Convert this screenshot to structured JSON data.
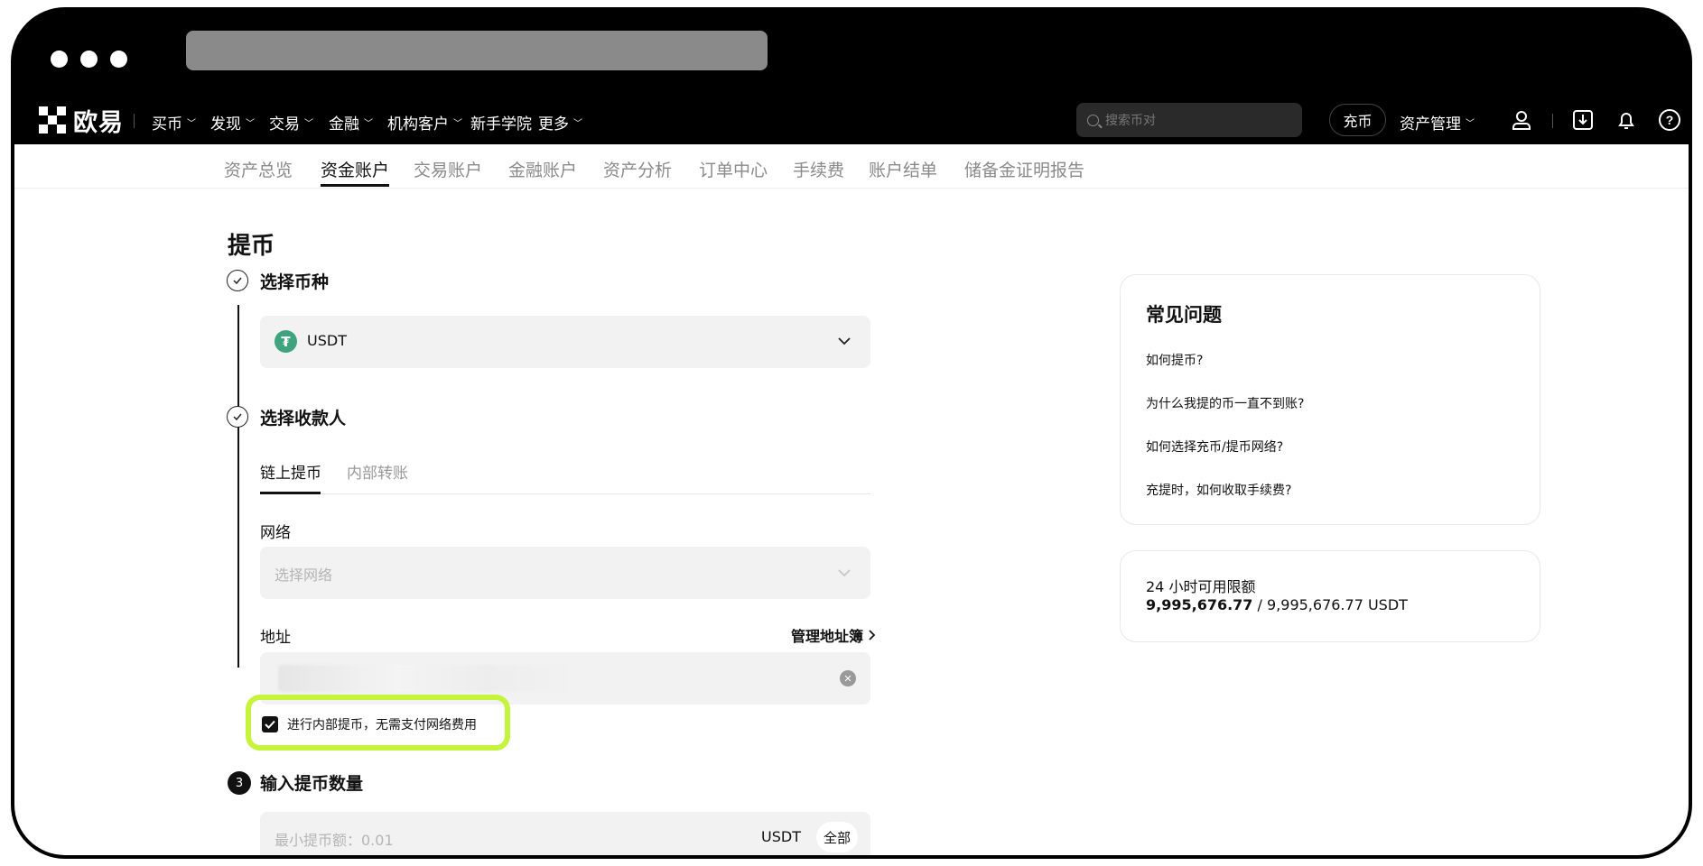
{
  "app": {
    "logo_text": "欧易"
  },
  "topnav": {
    "items": [
      "买币",
      "发现",
      "交易",
      "金融",
      "机构客户",
      "新手学院",
      "更多"
    ],
    "search_placeholder": "搜索币对",
    "deposit_label": "充币",
    "asset_management": "资产管理"
  },
  "subnav": {
    "items": [
      "资产总览",
      "资金账户",
      "交易账户",
      "金融账户",
      "资产分析",
      "订单中心",
      "手续费",
      "账户结单",
      "储备金证明报告"
    ],
    "active_index": 1
  },
  "page": {
    "title": "提币"
  },
  "steps": {
    "step1": {
      "title": "选择币种",
      "coin": "USDT",
      "coin_icon": "₮"
    },
    "step2": {
      "title": "选择收款人",
      "tabs": [
        "链上提币",
        "内部转账"
      ],
      "network_label": "网络",
      "network_placeholder": "选择网络",
      "address_label": "地址",
      "address_book": "管理地址簿",
      "internal_checkbox": {
        "label": "进行内部提币，无需支付网络费用",
        "checked": true
      }
    },
    "step3": {
      "number": "3",
      "title": "输入提币数量",
      "amount_placeholder": "最小提币额：0.01",
      "unit": "USDT",
      "all_label": "全部"
    }
  },
  "faq": {
    "title": "常见问题",
    "items": [
      "如何提币?",
      "为什么我提的币一直不到账?",
      "如何选择充币/提币网络?",
      "充提时，如何收取手续费?"
    ]
  },
  "limit": {
    "label": "24 小时可用限额",
    "available": "9,995,676.77",
    "separator": " / ",
    "total": "9,995,676.77 USDT"
  },
  "colors": {
    "highlight": "#c6f43c",
    "usdt": "#3fa47d"
  }
}
